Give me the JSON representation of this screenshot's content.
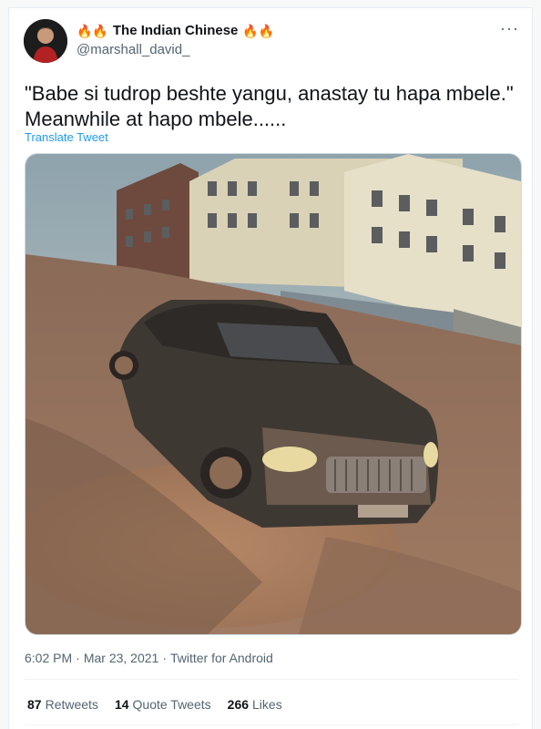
{
  "author": {
    "display_name": "The Indian Chinese",
    "handle": "@marshall_david_",
    "fire_emoji": "🔥🔥"
  },
  "menu_icon": "more-dots-icon",
  "more_glyph": "···",
  "tweet": {
    "text": "\"Babe si tudrop beshte yangu, anastay tu hapa mbele.\" Meanwhile at hapo mbele......",
    "translate_label": "Translate Tweet",
    "media_icon": "photo-muddy-car"
  },
  "meta": {
    "time": "6:02 PM",
    "separator": "·",
    "date": "Mar 23, 2021",
    "source": "Twitter for Android"
  },
  "stats": {
    "retweets_count": "87",
    "retweets_label": "Retweets",
    "quotes_count": "14",
    "quotes_label": "Quote Tweets",
    "likes_count": "266",
    "likes_label": "Likes"
  },
  "colors": {
    "link": "#1d9bf0",
    "secondary_text": "#536471",
    "primary_text": "#0f1419"
  }
}
